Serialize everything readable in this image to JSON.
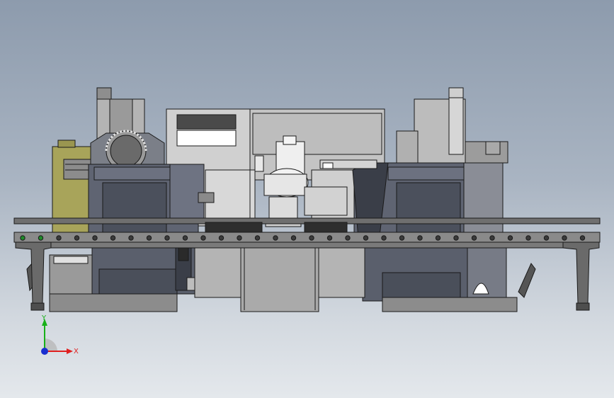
{
  "triad": {
    "x_label": "X",
    "y_label": "Y",
    "x_color": "#e02020",
    "y_color": "#18b018",
    "z_color": "#1a2fd0"
  },
  "colors": {
    "background_top": "#8d9bad",
    "background_bottom": "#e4e8ec",
    "machine_body": "#5f6472",
    "machine_dark": "#3a3e48",
    "rail": "#707070",
    "robot": "#e8e8e8",
    "cabinet_yellow": "#a8a45a"
  }
}
